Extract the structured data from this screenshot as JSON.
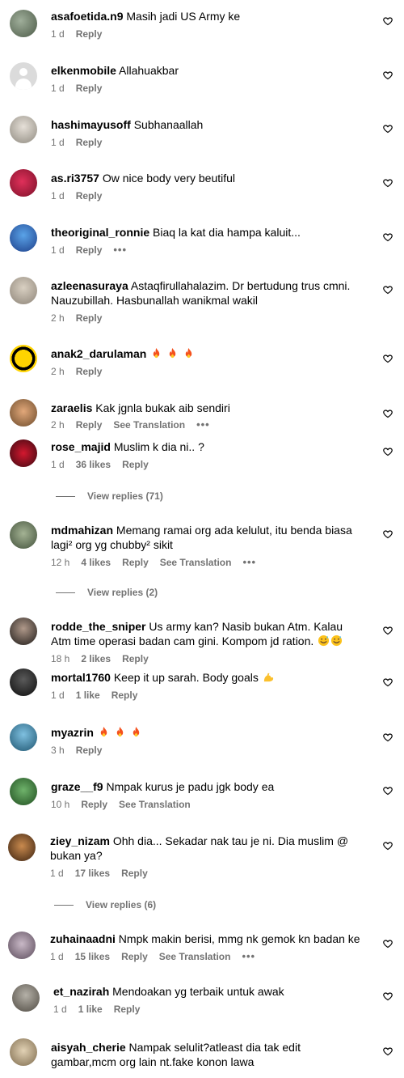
{
  "reply_label": "Reply",
  "see_translation_label": "See Translation",
  "more_label": "•••",
  "comments": [
    {
      "username": "asafoetida.n9",
      "text": "Masih jadi US Army ke",
      "time": "1 d"
    },
    {
      "username": "elkenmobile",
      "text": "Allahuakbar",
      "time": "1 d"
    },
    {
      "username": "hashimayusoff",
      "text": "Subhanaallah",
      "time": "1 d"
    },
    {
      "username": "as.ri3757",
      "text": "Ow nice body very beutiful",
      "time": "1 d"
    },
    {
      "username": "theoriginal_ronnie",
      "text": "Biaq la kat dia hampa kaluit...",
      "time": "1 d"
    },
    {
      "username": "azleenasuraya",
      "text": "Astaqfirullahalazim. Dr bertudung trus cmni. Nauzubillah. Hasbunallah wanikmal wakil",
      "time": "2 h"
    },
    {
      "username": "anak2_darulaman",
      "text": "",
      "time": "2 h"
    },
    {
      "username": "zaraelis",
      "text": "Kak jgnla bukak aib sendiri",
      "time": "2 h"
    },
    {
      "username": "rose_majid",
      "text": "Muslim k dia ni.. ?",
      "time": "1 d",
      "likes": "36 likes"
    },
    {
      "username": "mdmahizan",
      "text": "Memang ramai org ada kelulut, itu benda biasa lagi² org yg chubby² sikit",
      "time": "12 h",
      "likes": "4 likes"
    },
    {
      "username": "rodde_the_sniper",
      "text": "Us army kan? Nasib bukan Atm. Kalau Atm time operasi badan cam gini. Kompom jd ration.",
      "time": "18 h",
      "likes": "2 likes"
    },
    {
      "username": "mortal1760",
      "text": "Keep it up sarah. Body goals",
      "time": "1 d",
      "likes": "1 like"
    },
    {
      "username": "myazrin",
      "text": "",
      "time": "3 h"
    },
    {
      "username": "graze__f9",
      "text": "Nmpak kurus je padu jgk body ea",
      "time": "10 h"
    },
    {
      "username": "ziey_nizam",
      "text": "Ohh dia... Sekadar nak tau je ni. Dia muslim @ bukan ya?",
      "time": "1 d",
      "likes": "17 likes"
    },
    {
      "username": "zuhainaadni",
      "text": "Nmpk makin berisi, mmg nk gemok kn badan ke",
      "time": "1 d",
      "likes": "15 likes"
    },
    {
      "username": "et_nazirah",
      "text": "Mendoakan yg terbaik untuk awak",
      "time": "1 d",
      "likes": "1 like"
    },
    {
      "username": "aisyah_cherie",
      "text": "Nampak selulit?atleast dia tak edit gambar,mcm org lain nt.fake konon lawa",
      "time": ""
    }
  ],
  "view_replies": [
    {
      "label": "View replies (71)"
    },
    {
      "label": "View replies (2)"
    },
    {
      "label": "View replies (6)"
    }
  ],
  "colors": {
    "meta": "#737373",
    "text": "#000000",
    "background": "#ffffff",
    "fire": "#f4511e"
  },
  "icons": {
    "like": "heart-outline-icon",
    "fire": "fire-emoji-icon",
    "sweat_smile": "sweat-smile-emoji-icon",
    "muscle": "flexed-biceps-emoji-icon"
  }
}
